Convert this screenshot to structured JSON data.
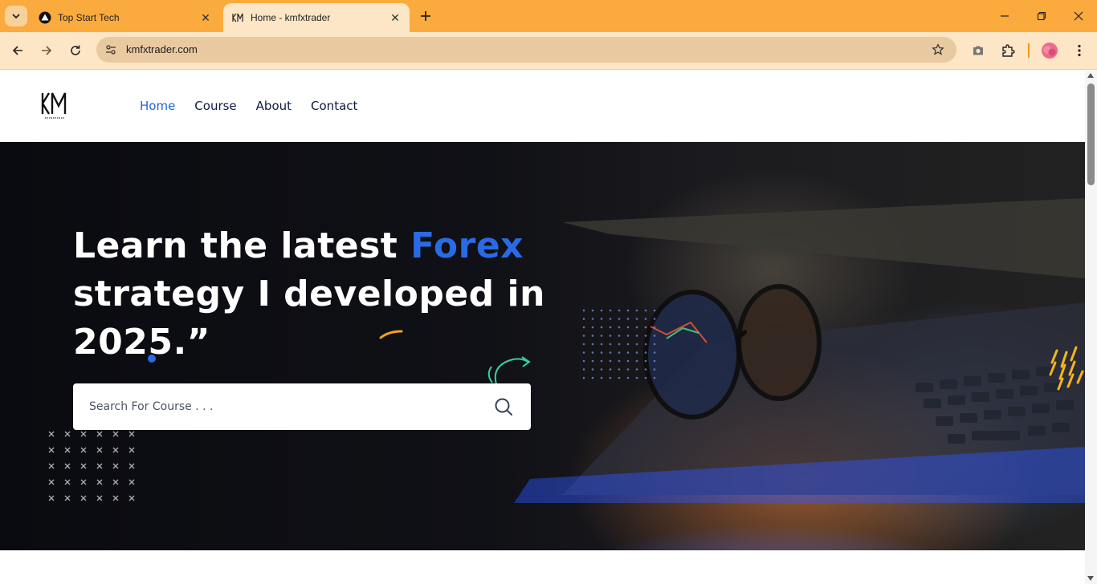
{
  "browser": {
    "tabs": [
      {
        "title": "Top Start Tech",
        "active": false,
        "favicon": "triangle-logo-icon"
      },
      {
        "title": "Home - kmfxtrader",
        "active": true,
        "favicon": "km-logo-icon"
      }
    ],
    "url": "kmfxtrader.com",
    "accent_color": "#fbab3d"
  },
  "site": {
    "logo_alt": "KM",
    "nav": [
      {
        "label": "Home",
        "active": true
      },
      {
        "label": "Course",
        "active": false
      },
      {
        "label": "About",
        "active": false
      },
      {
        "label": "Contact",
        "active": false
      }
    ],
    "hero": {
      "title_part1": "Learn the latest ",
      "title_highlight": "Forex",
      "title_part2": " strategy I developed in 2025.”",
      "search_placeholder": "Search For Course . . ."
    },
    "colors": {
      "accent_blue": "#2a6ae4",
      "nav_text": "#0d1b3e",
      "nav_active": "#2166d8"
    }
  }
}
